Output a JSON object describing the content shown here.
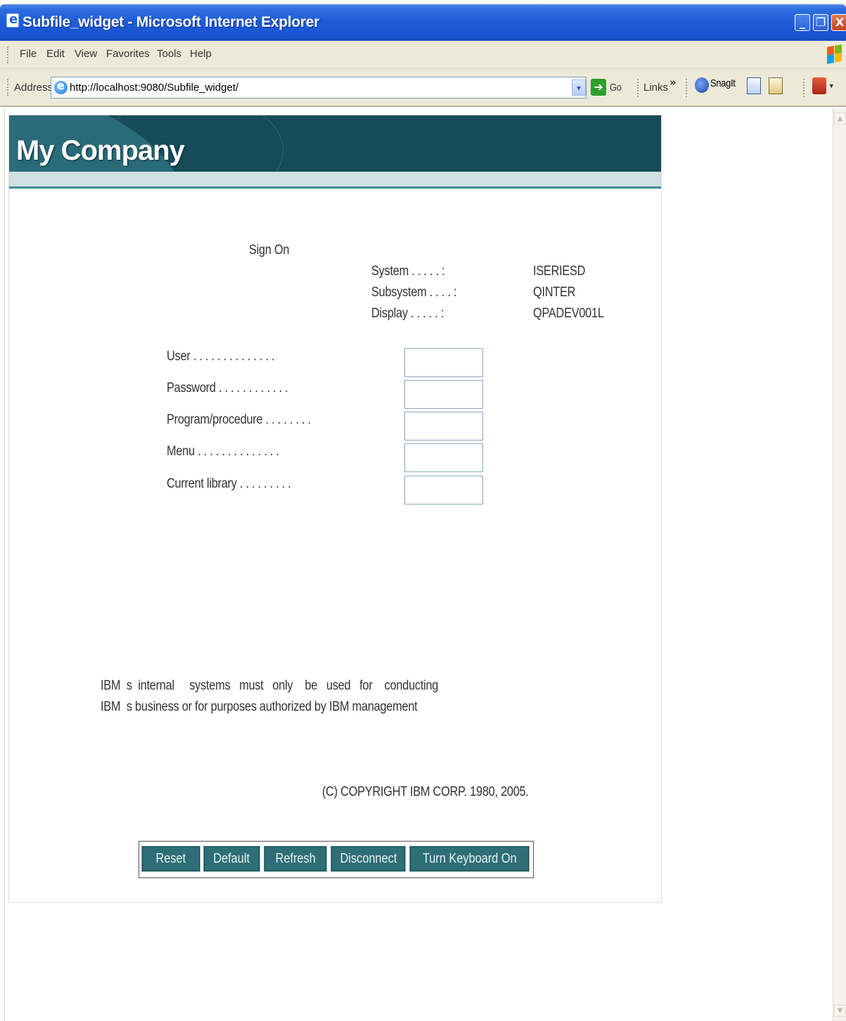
{
  "window": {
    "title": "Subfile_widget - Microsoft Internet Explorer",
    "controls": {
      "minimize": "_",
      "maximize": "❐",
      "close": "X"
    }
  },
  "menu": [
    "File",
    "Edit",
    "View",
    "Favorites",
    "Tools",
    "Help"
  ],
  "address_bar": {
    "label": "Address",
    "url": "http://localhost:9080/Subfile_widget/",
    "go_label": "Go",
    "links_label": "Links",
    "snagit_label": "SnagIt"
  },
  "banner": {
    "company": "My Company"
  },
  "signon": {
    "heading": "Sign On",
    "system_info": [
      {
        "label": "System . . . . . :",
        "value": "ISERIESD"
      },
      {
        "label": "Subsystem . . . . :",
        "value": "QINTER"
      },
      {
        "label": "Display . . . . . :",
        "value": "QPADEV001L"
      }
    ],
    "fields": [
      {
        "label": "User . . . . . . . . . . . . . .",
        "value": ""
      },
      {
        "label": "Password . . . . . . . . . . . .",
        "value": ""
      },
      {
        "label": "Program/procedure . . . . . . . .",
        "value": ""
      },
      {
        "label": "Menu . . . . . . . . . . . . . .",
        "value": ""
      },
      {
        "label": "Current library . . . . . . . . .",
        "value": ""
      }
    ],
    "notice_line1": "IBM  s  internal     systems   must   only    be   used   for    conducting",
    "notice_line2": "IBM  s business or for purposes authorized by IBM management",
    "copyright": "(C) COPYRIGHT IBM CORP. 1980, 2005."
  },
  "buttons": {
    "reset": "Reset",
    "default": "Default",
    "refresh": "Refresh",
    "disconnect": "Disconnect",
    "keyboard": "Turn Keyboard On"
  },
  "colors": {
    "banner": "#164b58",
    "button": "#2e6e76",
    "titlebar": "#1d5bd7"
  }
}
